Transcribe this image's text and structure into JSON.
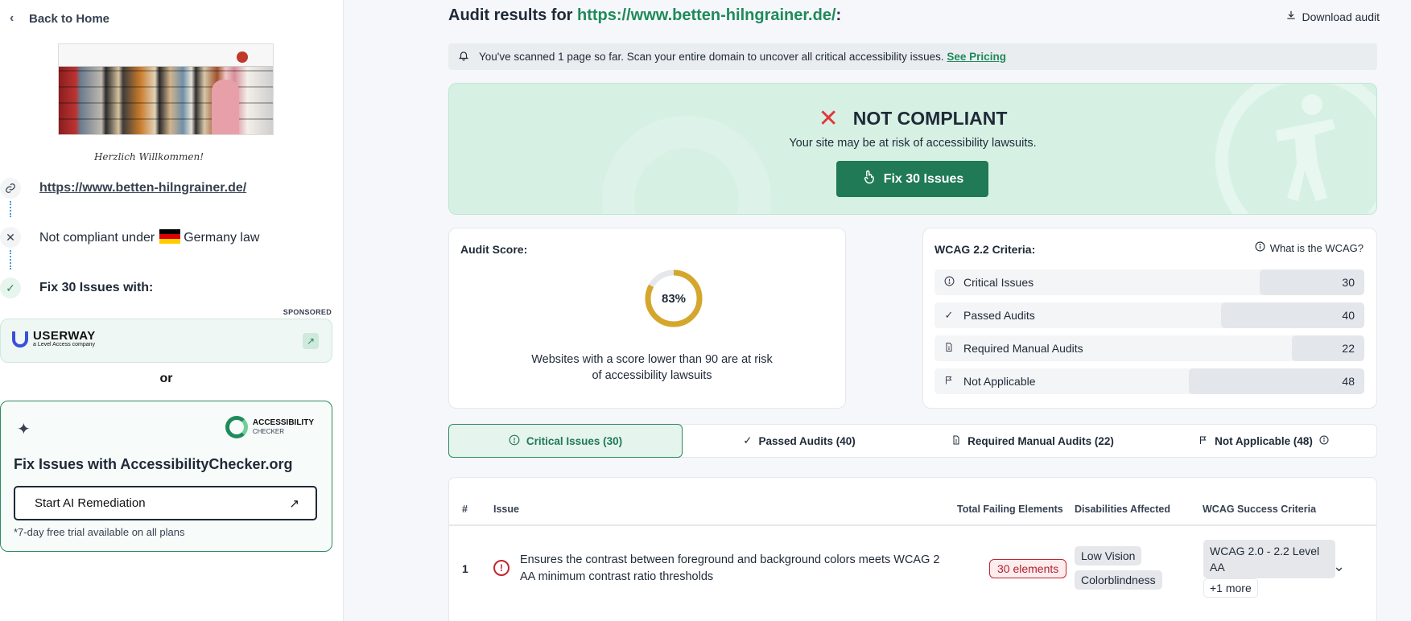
{
  "sidebar": {
    "back_label": "Back to Home",
    "welcome_text": "Herzlich Willkommen!",
    "steps": {
      "url": "https://www.betten-hilngrainer.de/",
      "law_prefix": "Not compliant under",
      "law_country": "Germany law",
      "fix": "Fix 30 Issues with:"
    },
    "sponsored": "SPONSORED",
    "userway": {
      "name": "USERWAY",
      "sub": "a Level Access company"
    },
    "or": "or",
    "accessibility_checker": {
      "logo_line1": "ACCESSIBILITY",
      "logo_line2": "CHECKER",
      "title": "Fix Issues with AccessibilityChecker.org",
      "button": "Start AI Remediation",
      "trial": "*7-day free trial available on all plans"
    }
  },
  "header": {
    "title_prefix": "Audit results for",
    "url": "https://www.betten-hilngrainer.de/",
    "title_suffix": ":",
    "download": "Download audit"
  },
  "notice": {
    "text": "You've scanned 1 page so far. Scan your entire domain to uncover all critical accessibility issues.",
    "link": "See Pricing"
  },
  "hero": {
    "status": "NOT COMPLIANT",
    "risk": "Your site may be at risk of accessibility lawsuits.",
    "button": "Fix 30 Issues"
  },
  "score": {
    "label": "Audit Score:",
    "value": "83%",
    "percent": 83,
    "description": "Websites with a score lower than 90 are at risk of accessibility lawsuits"
  },
  "wcag": {
    "label": "WCAG 2.2 Criteria:",
    "what": "What is the WCAG?",
    "rows": [
      {
        "label": "Critical Issues",
        "count": "30",
        "icon": "alert-circle-icon"
      },
      {
        "label": "Passed Audits",
        "count": "40",
        "icon": "check-icon"
      },
      {
        "label": "Required Manual Audits",
        "count": "22",
        "icon": "document-icon"
      },
      {
        "label": "Not Applicable",
        "count": "48",
        "icon": "flag-icon"
      }
    ]
  },
  "tabs": [
    {
      "label": "Critical Issues (30)"
    },
    {
      "label": "Passed Audits (40)"
    },
    {
      "label": "Required Manual Audits (22)"
    },
    {
      "label": "Not Applicable (48)"
    }
  ],
  "table": {
    "headers": [
      "#",
      "Issue",
      "Total Failing Elements",
      "Disabilities Affected",
      "WCAG Success Criteria"
    ],
    "rows": [
      {
        "num": "1",
        "issue": "Ensures the contrast between foreground and background colors meets WCAG 2 AA minimum contrast ratio thresholds",
        "failing": "30 elements",
        "disabilities": [
          "Low Vision",
          "Colorblindness"
        ],
        "criteria": "WCAG 2.0 - 2.2 Level AA",
        "more": "+1 more"
      }
    ]
  },
  "colors": {
    "brand_green": "#1f7a55",
    "danger_red": "#e0393e",
    "score_ring": "#d4a72c"
  }
}
